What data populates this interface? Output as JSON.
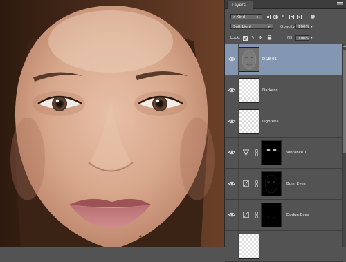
{
  "panel": {
    "tab_label": "Layers",
    "filter_value": "Kind",
    "blend_mode": "Soft Light",
    "opacity_label": "Opacity:",
    "opacity_value": "100%",
    "lock_label": "Lock:",
    "fill_label": "Fill:",
    "fill_value": "100%"
  },
  "layers": [
    {
      "name": "D&B 01",
      "type": "pixel",
      "selected": true
    },
    {
      "name": "Darkens",
      "type": "pixel",
      "selected": false
    },
    {
      "name": "Lightens",
      "type": "pixel",
      "selected": false
    },
    {
      "name": "Vibrance 1",
      "type": "adjustment",
      "icon": "vibrance-icon",
      "selected": false
    },
    {
      "name": "Burn Eyes",
      "type": "adjustment",
      "icon": "curves-icon",
      "selected": false
    },
    {
      "name": "Dodge Eyes",
      "type": "adjustment",
      "icon": "curves-icon",
      "selected": false
    }
  ],
  "colors": {
    "selected_row": "#8396b2",
    "panel_bg": "#535353"
  }
}
